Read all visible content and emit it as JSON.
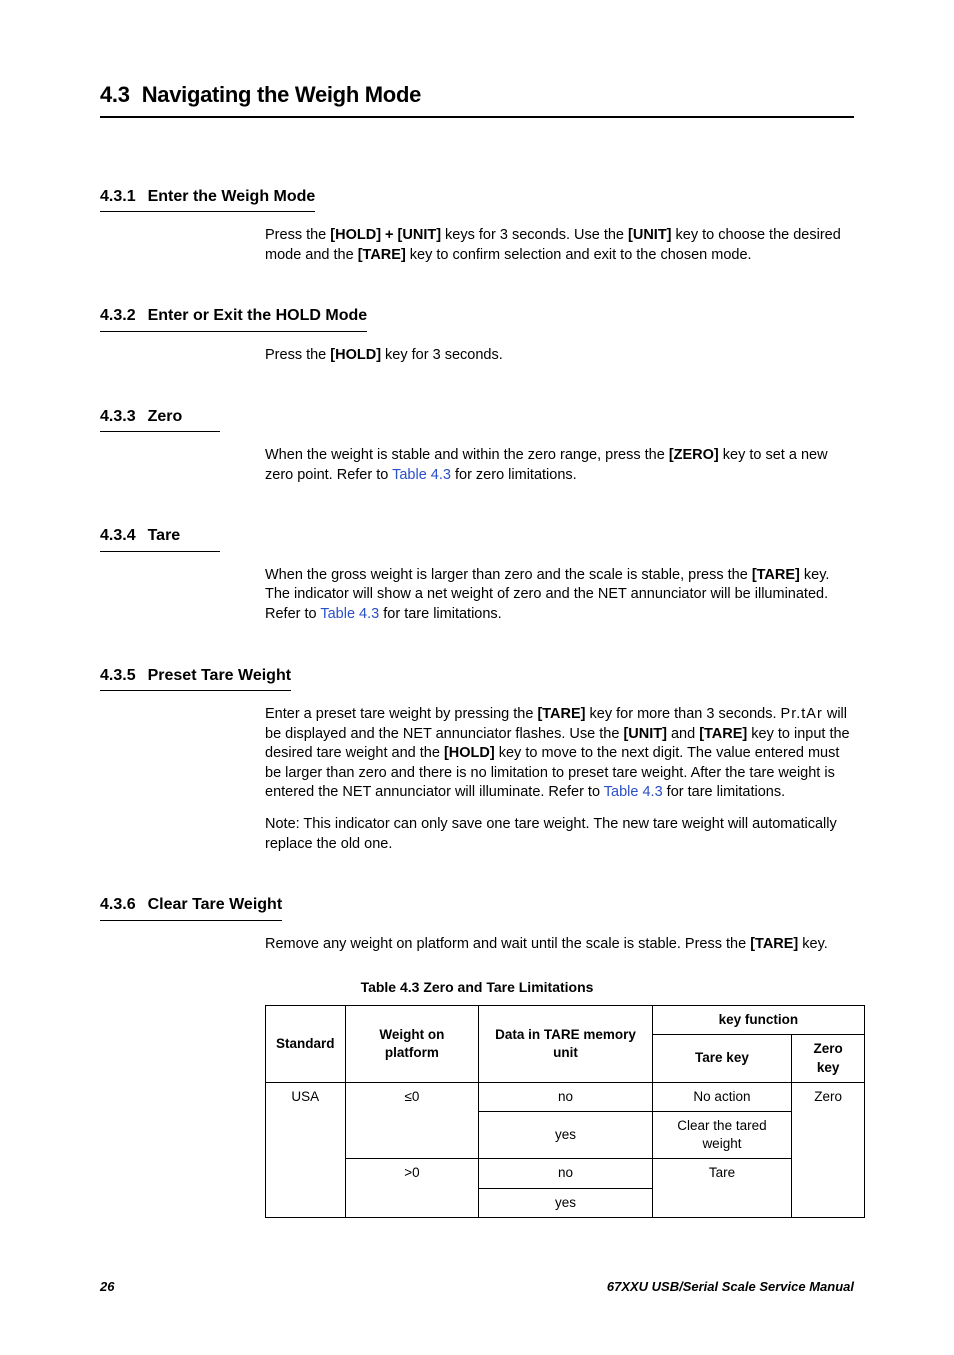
{
  "main": {
    "num": "4.3",
    "title": "Navigating the Weigh Mode"
  },
  "s431": {
    "num": "4.3.1",
    "title": "Enter the Weigh Mode",
    "p1a": "Press the ",
    "p1b": "[HOLD] + [UNIT]",
    "p1c": " keys for 3 seconds. Use the ",
    "p1d": "[UNIT]",
    "p1e": " key to choose the desired mode and the ",
    "p1f": "[TARE]",
    "p1g": " key to confirm selection and exit to the chosen mode."
  },
  "s432": {
    "num": "4.3.2",
    "title": "Enter or Exit the HOLD Mode",
    "p1a": "Press the ",
    "p1b": "[HOLD]",
    "p1c": " key for 3 seconds."
  },
  "s433": {
    "num": "4.3.3",
    "title": "Zero",
    "p1a": "When the weight is stable and within the zero range, press the ",
    "p1b": "[ZERO]",
    "p1c": " key to set a new zero point. Refer to ",
    "p1d": "Table 4.3",
    "p1e": " for zero limitations."
  },
  "s434": {
    "num": "4.3.4",
    "title": "Tare",
    "p1a": "When the gross weight is larger than zero and the scale is stable, press the ",
    "p1b": "[TARE]",
    "p1c": " key. The indicator will show a net weight of zero and the NET annunciator will be illuminated. Refer to ",
    "p1d": "Table 4.3",
    "p1e": " for tare limitations."
  },
  "s435": {
    "num": "4.3.5",
    "title": "Preset Tare Weight",
    "p1a": "Enter a preset tare weight by pressing the ",
    "p1b": "[TARE]",
    "p1c": " key for more than 3 seconds. ",
    "seg": "Pr.tAr",
    "p1d": " will be displayed and the NET annunciator flashes. Use the ",
    "p1e": "[UNIT]",
    "p1f": " and ",
    "p1g": "[TARE]",
    "p1h": " key to input the desired tare weight and the ",
    "p1i": "[HOLD]",
    "p1j": " key to move to the next digit. The value entered must be larger than zero and there is no limitation to preset tare weight. After the tare weight is entered the NET annunciator will illuminate. Refer to ",
    "p1k": "Table 4.3",
    "p1l": " for tare limitations.",
    "p2": "Note: This indicator can only save one tare weight. The new tare weight will automatically replace the old one."
  },
  "s436": {
    "num": "4.3.6",
    "title": "Clear Tare Weight",
    "p1a": "Remove any weight on platform and wait until the scale is stable. Press the ",
    "p1b": "[TARE]",
    "p1c": " key."
  },
  "tableCaption": "Table 4.3  Zero and Tare Limitations",
  "table": {
    "h1": "Standard",
    "h2": "Weight on platform",
    "h3": "Data in TARE memory unit",
    "h4": "key function",
    "h4a": "Tare key",
    "h4b": "Zero key",
    "r_std": "USA",
    "r_w1": "≤0",
    "r_w2": ">0",
    "r_d_no": "no",
    "r_d_yes": "yes",
    "r_t1": "No action",
    "r_t2": "Clear the tared weight",
    "r_t3": "Tare",
    "r_z": "Zero"
  },
  "footer": {
    "page": "26",
    "doc": "67XXU USB/Serial Scale Service Manual"
  }
}
